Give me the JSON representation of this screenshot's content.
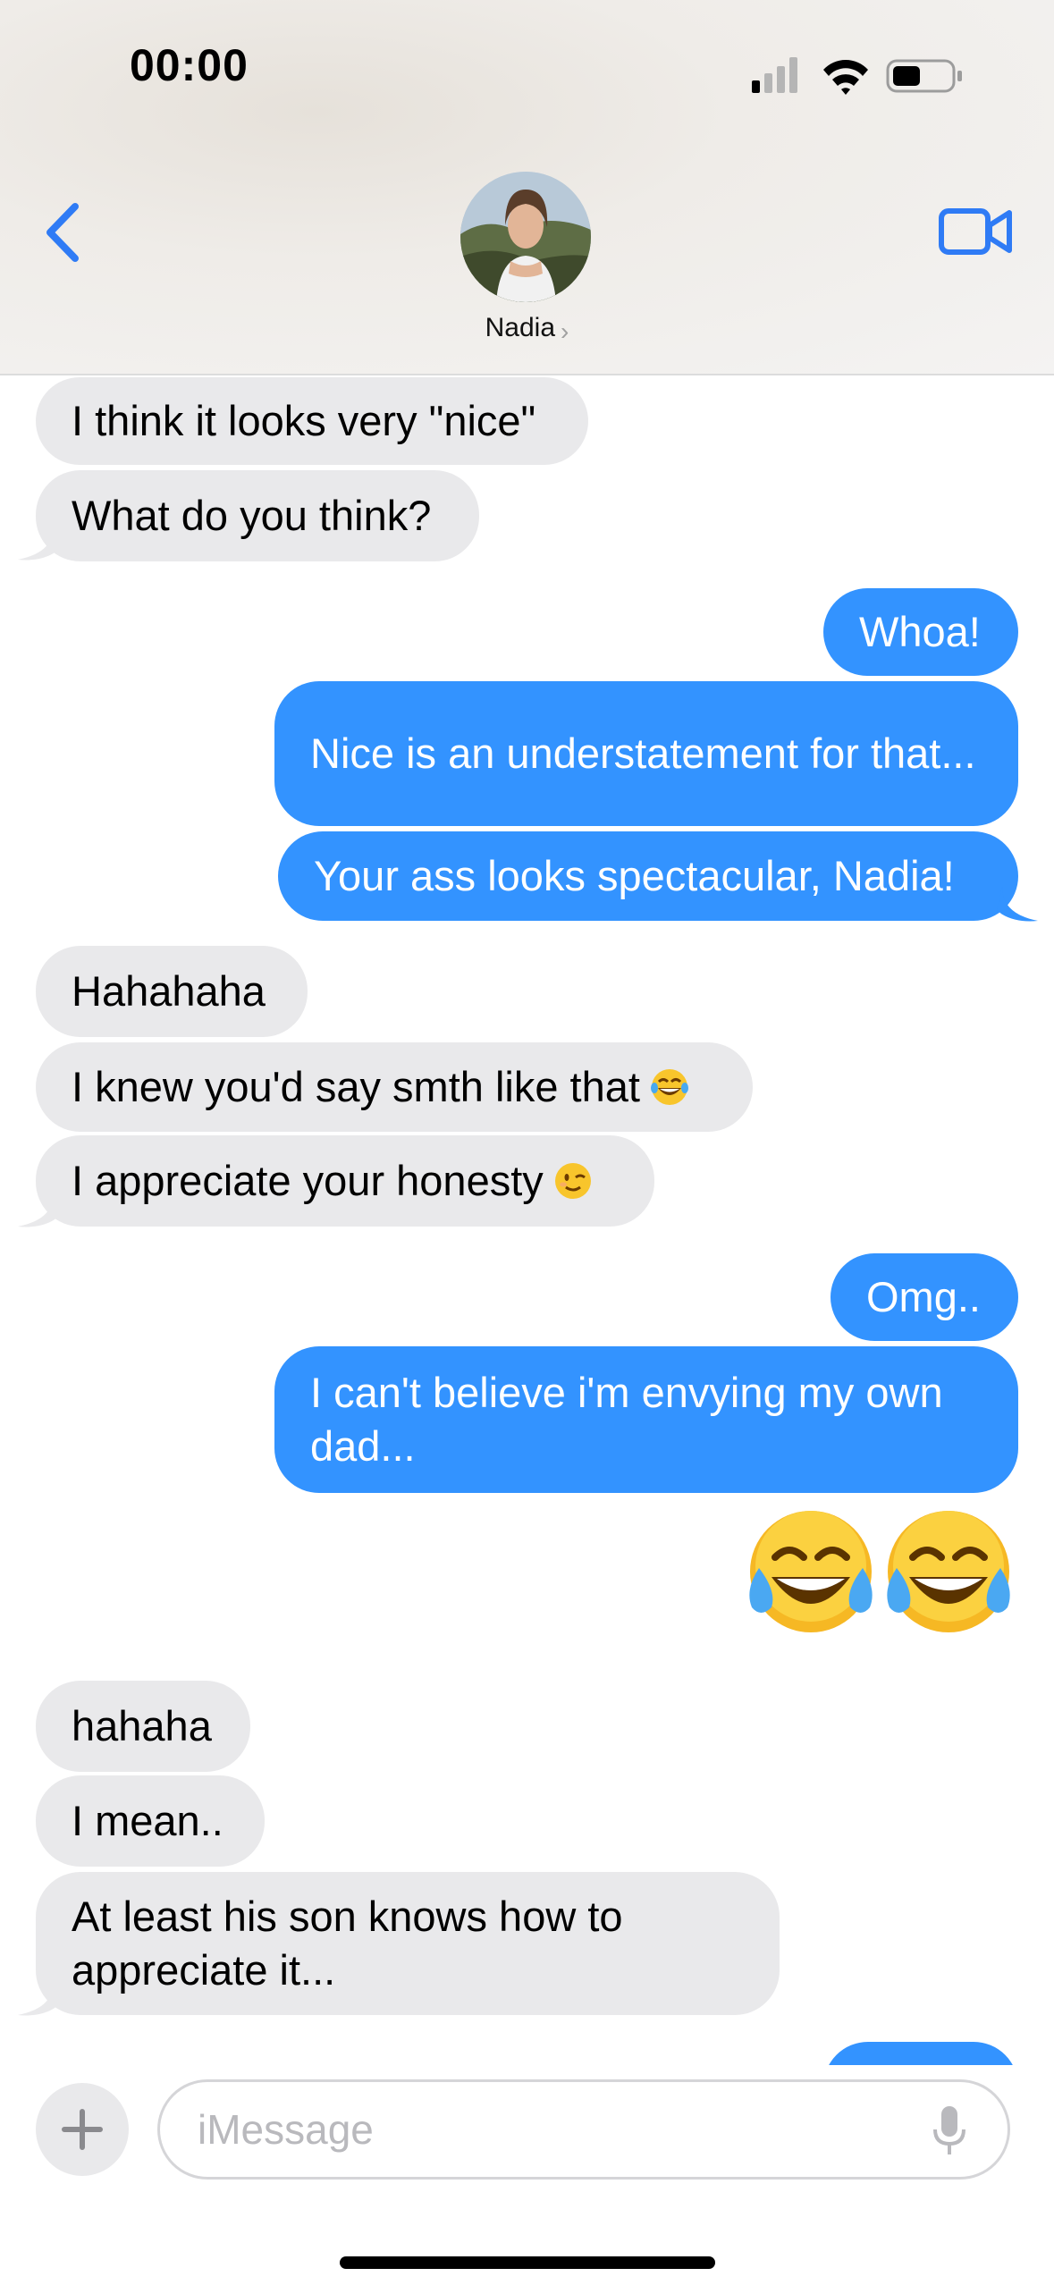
{
  "status_bar": {
    "time": "00:00"
  },
  "header": {
    "contact_name": "Nadia",
    "chevron": "›"
  },
  "messages": [
    {
      "id": "m1",
      "sender": "them",
      "text": "I think it looks very \"nice\""
    },
    {
      "id": "m2",
      "sender": "them",
      "text": "What do you think?"
    },
    {
      "id": "m3",
      "sender": "me",
      "text": "Whoa!"
    },
    {
      "id": "m4",
      "sender": "me",
      "text": "Nice is an understatement for that..."
    },
    {
      "id": "m5",
      "sender": "me",
      "text": "Your ass looks spectacular, Nadia!"
    },
    {
      "id": "m6",
      "sender": "them",
      "text": "Hahahaha"
    },
    {
      "id": "m7",
      "sender": "them",
      "text": "I knew you'd say smth like that",
      "emoji": "tears-of-joy"
    },
    {
      "id": "m8",
      "sender": "them",
      "text": "I appreciate your honesty",
      "emoji": "wink"
    },
    {
      "id": "m9",
      "sender": "me",
      "text": "Omg.."
    },
    {
      "id": "m10",
      "sender": "me",
      "text": "I can't believe i'm envying my own dad..."
    },
    {
      "id": "m11",
      "sender": "me",
      "text": "",
      "emoji": "tears-of-joy x2"
    },
    {
      "id": "m12",
      "sender": "them",
      "text": "hahaha"
    },
    {
      "id": "m13",
      "sender": "them",
      "text": "I mean.."
    },
    {
      "id": "m14",
      "sender": "them",
      "text": "At least his son knows how to appreciate it..."
    }
  ],
  "composer": {
    "placeholder": "iMessage"
  },
  "colors": {
    "sent_bubble": "#3393ff",
    "received_bubble": "#e9e9eb",
    "accent": "#2f7bf5"
  },
  "icons": [
    "back-chevron-icon",
    "video-call-icon",
    "plus-icon",
    "microphone-icon",
    "cellular-signal-icon",
    "wifi-icon",
    "battery-icon"
  ]
}
